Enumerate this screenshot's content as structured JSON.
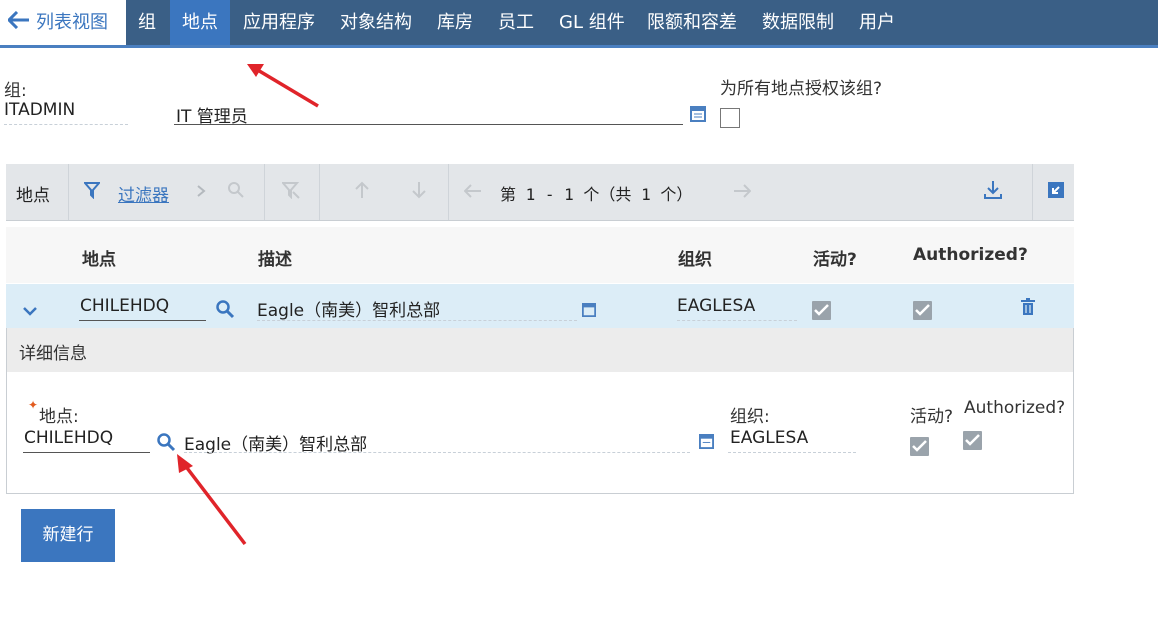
{
  "tabs": {
    "list_view": "列表视图",
    "items": [
      "组",
      "地点",
      "应用程序",
      "对象结构",
      "库房",
      "员工",
      "GL 组件",
      "限额和容差",
      "数据限制",
      "用户"
    ],
    "active": "地点"
  },
  "group": {
    "label": "组:",
    "code": "ITADMIN",
    "description": "IT 管理员",
    "authorize_all_label": "为所有地点授权该组?",
    "authorize_all_checked": false
  },
  "table": {
    "title": "地点",
    "filter_label": "过滤器",
    "pagination": "第 1 - 1 个（共 1 个）",
    "columns": [
      "地点",
      "描述",
      "组织",
      "活动?",
      "Authorized?"
    ],
    "rows": [
      {
        "location": "CHILEHDQ",
        "description": "Eagle（南美）智利总部",
        "organization": "EAGLESA",
        "active": true,
        "authorized": true
      }
    ]
  },
  "details": {
    "title": "详细信息",
    "location_label": "地点:",
    "location_value": "CHILEHDQ",
    "description_value": "Eagle（南美）智利总部",
    "org_label": "组织:",
    "org_value": "EAGLESA",
    "active_label": "活动?",
    "authorized_label": "Authorized?"
  },
  "new_row_button": "新建行",
  "colors": {
    "tabbar": "#3a5f86",
    "accent": "#3b76bf",
    "row_selected": "#dcedf7",
    "annotation_arrow": "#e0242a"
  }
}
